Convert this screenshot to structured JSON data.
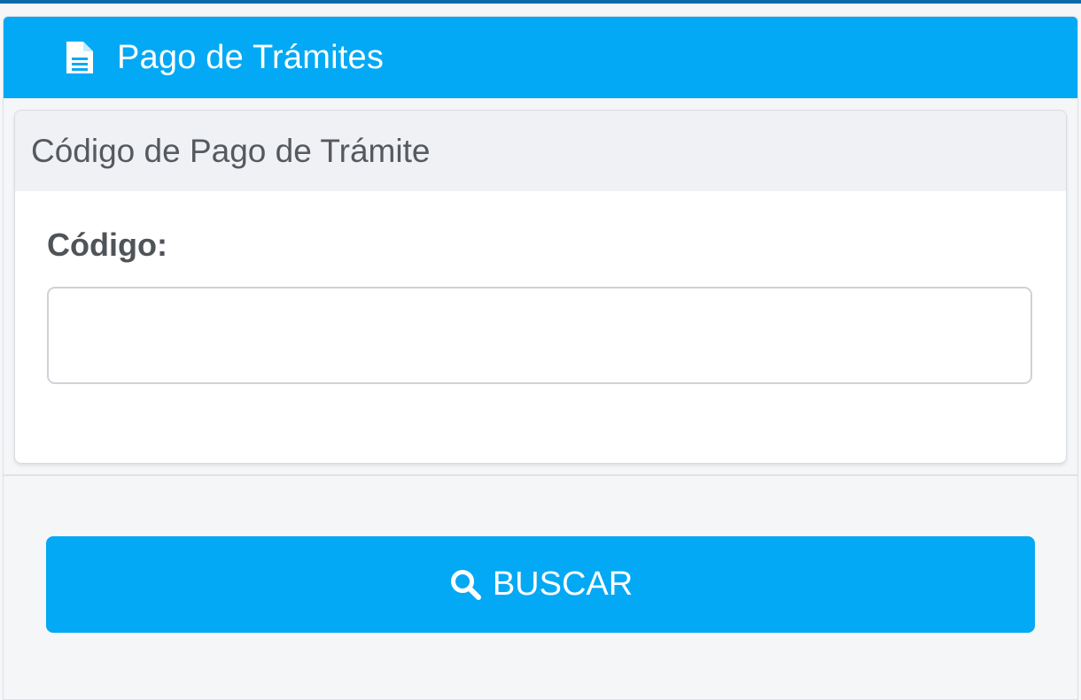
{
  "header": {
    "title": "Pago de Trámites",
    "icon": "document-icon"
  },
  "card": {
    "title": "Código de Pago de Trámite"
  },
  "form": {
    "code_label": "Código:",
    "code_value": ""
  },
  "actions": {
    "search_label": "BUSCAR",
    "search_icon": "search-icon"
  },
  "colors": {
    "primary": "#03a9f4",
    "top_strip": "#0a6aa8",
    "card_header_bg": "#f0f1f5",
    "page_bg": "#f5f6f8"
  }
}
